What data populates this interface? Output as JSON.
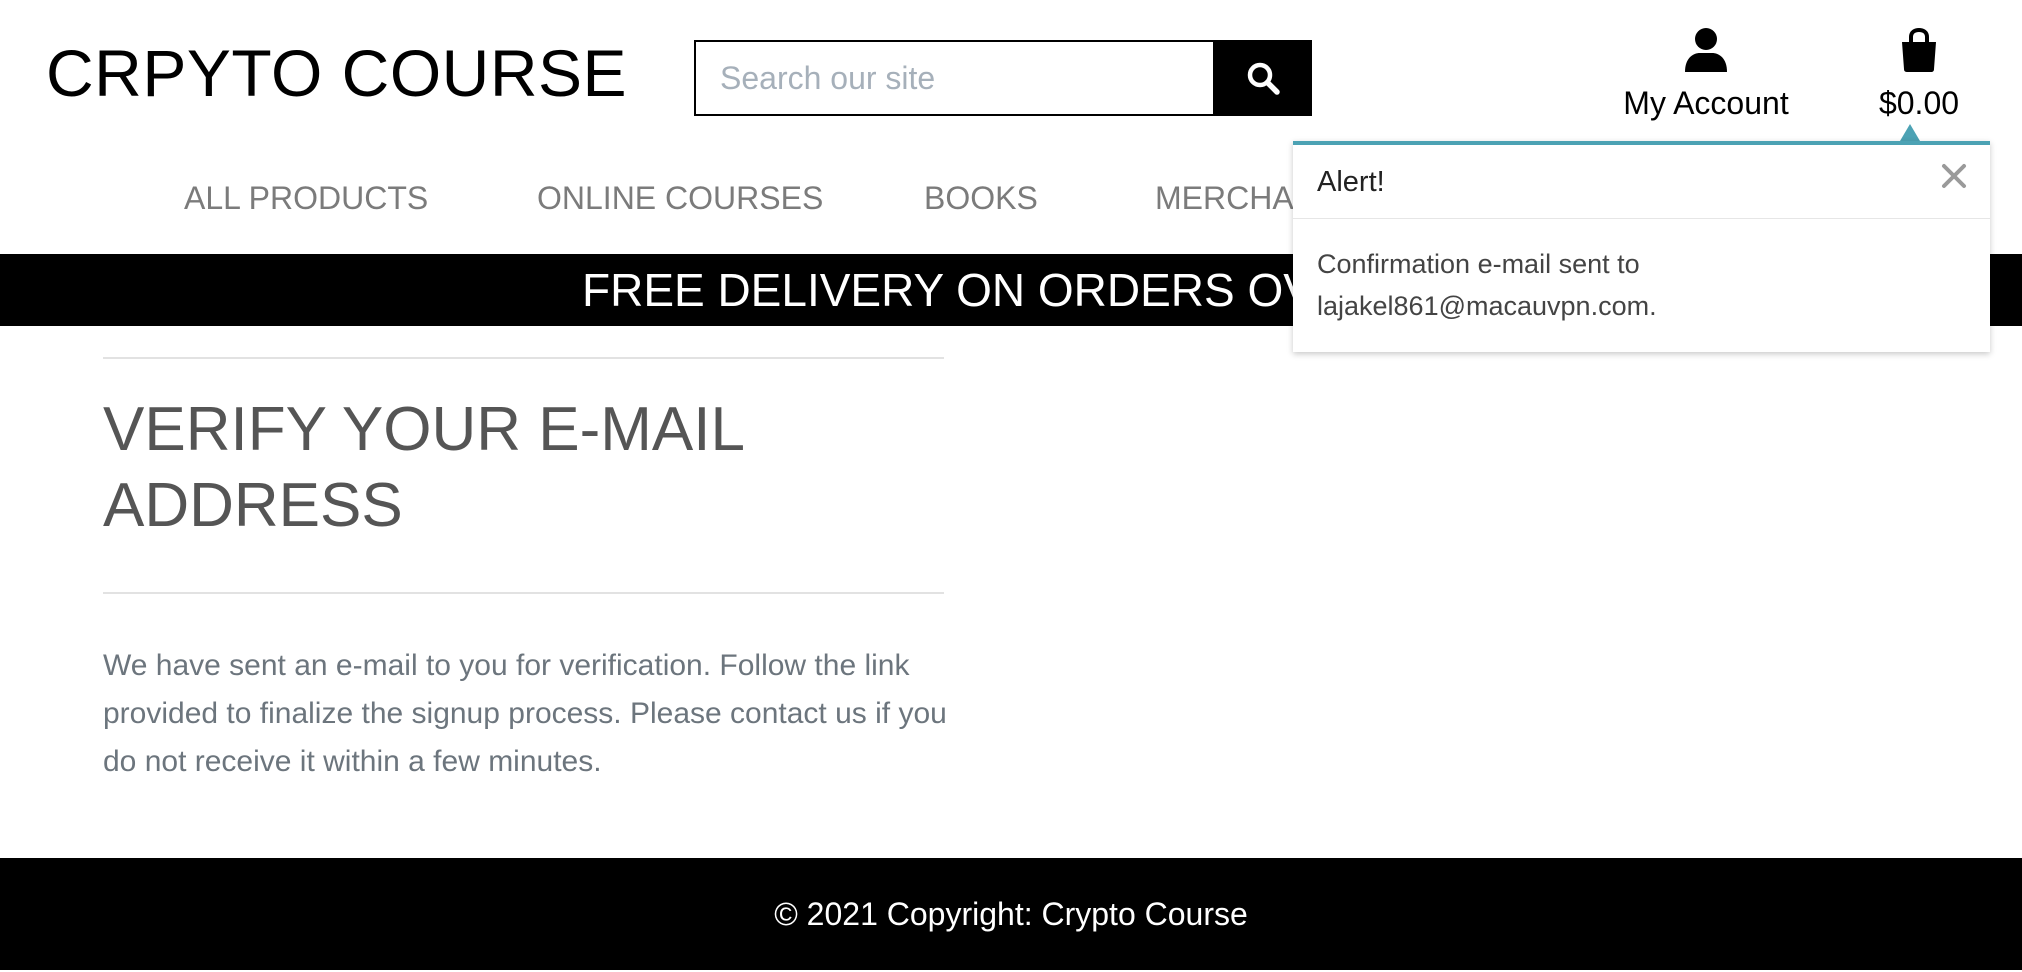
{
  "header": {
    "logo": "CRPYTO COURSE",
    "search_placeholder": "Search our site",
    "search_icon": "search-icon",
    "account_label": "My Account",
    "account_icon": "user-icon",
    "cart_total": "$0.00",
    "cart_icon": "shopping-bag-icon"
  },
  "nav": {
    "items": [
      {
        "label": "ALL PRODUCTS"
      },
      {
        "label": "ONLINE COURSES"
      },
      {
        "label": "BOOKS"
      },
      {
        "label": "MERCHAN"
      }
    ]
  },
  "banner": {
    "text": "FREE DELIVERY ON ORDERS OVE"
  },
  "main": {
    "title": "VERIFY YOUR E-MAIL ADDRESS",
    "text": "We have sent an e-mail to you for verification. Follow the link provided to finalize the signup process. Please contact us if you do not receive it within a few minutes."
  },
  "alert": {
    "title": "Alert!",
    "close_icon": "close-icon",
    "line1": "Confirmation e-mail sent to",
    "line2": "lajakel861@macauvpn.com."
  },
  "footer": {
    "text": "© 2021 Copyright: Crypto Course"
  },
  "colors": {
    "banner_bg": "#000000",
    "footer_bg": "#000000",
    "alert_accent": "#4ca2b4",
    "nav_text": "#7b7b7b",
    "body_text": "#6c757d",
    "title_text": "#555555"
  }
}
